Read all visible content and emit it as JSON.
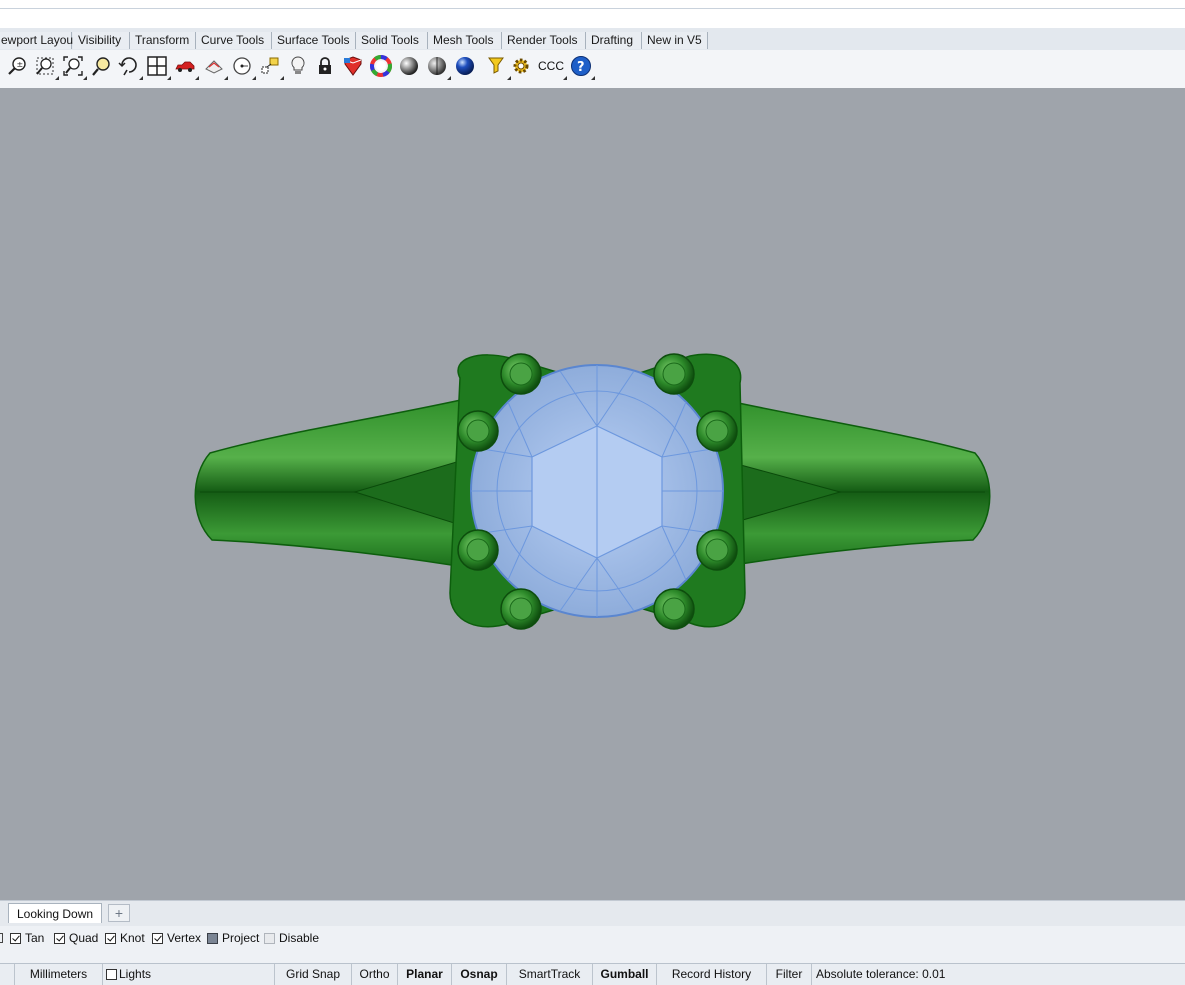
{
  "toolbar_tabs": [
    "ewport Layout",
    "Visibility",
    "Transform",
    "Curve Tools",
    "Surface Tools",
    "Solid Tools",
    "Mesh Tools",
    "Render Tools",
    "Drafting",
    "New in V5"
  ],
  "toolbar_icons": [
    "zoom-extents-icon",
    "zoom-window-icon",
    "zoom-all-icon",
    "zoom-selected-icon",
    "rotate-view-icon",
    "four-viewports-icon",
    "car-shaded-icon",
    "named-view-icon",
    "circle-point-icon",
    "object-snap-icon",
    "light-bulb-icon",
    "lock-icon",
    "layer-color-icon",
    "color-wheel-icon",
    "shade-sphere-icon",
    "render-sphere-icon",
    "blue-sphere-icon",
    "filter-icon",
    "settings-gear-icon",
    "ccc-label",
    "help-icon"
  ],
  "toolbar_ccc_label": "CCC",
  "viewport": {
    "background": "#9fa4ab",
    "model": {
      "band_color": "#1f7a1f",
      "gem_color": "#a8c4f0"
    }
  },
  "viewport_tabs": {
    "active": "Looking Down",
    "add_symbol": "+"
  },
  "osnap": [
    {
      "label": "Tan",
      "checked": true
    },
    {
      "label": "Quad",
      "checked": true
    },
    {
      "label": "Knot",
      "checked": true
    },
    {
      "label": "Vertex",
      "checked": true
    },
    {
      "label": "Project",
      "checked": false,
      "style": "filled"
    },
    {
      "label": "Disable",
      "checked": false,
      "style": "empty"
    }
  ],
  "status": {
    "units": "Millimeters",
    "lights": "Lights",
    "grid_snap": "Grid Snap",
    "ortho": "Ortho",
    "planar": "Planar",
    "osnap": "Osnap",
    "smarttrack": "SmartTrack",
    "gumball": "Gumball",
    "record_history": "Record History",
    "filter": "Filter",
    "tolerance": "Absolute tolerance: 0.01"
  }
}
